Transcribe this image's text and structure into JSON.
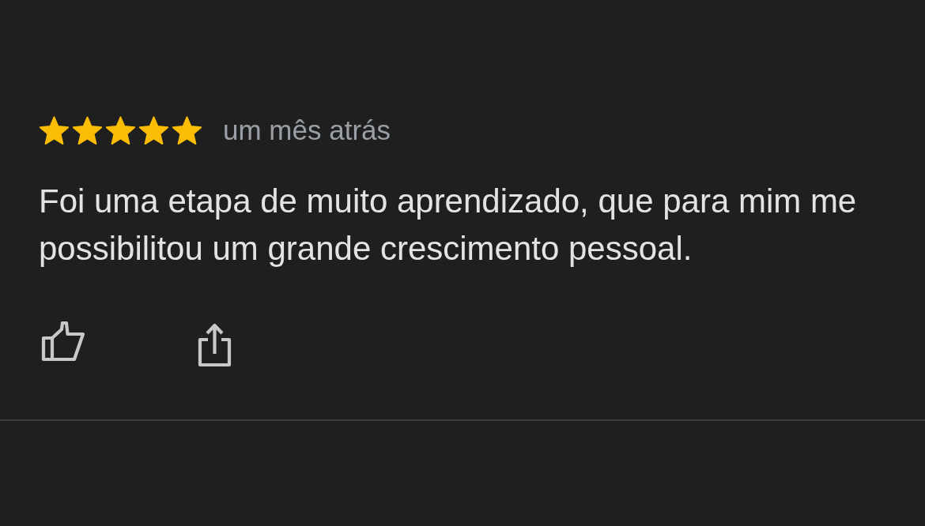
{
  "review": {
    "stars": 5,
    "time": "um mês atrás",
    "text": "Foi uma etapa de muito aprendizado, que para mim me possibilitou um grande crescimento pessoal."
  }
}
